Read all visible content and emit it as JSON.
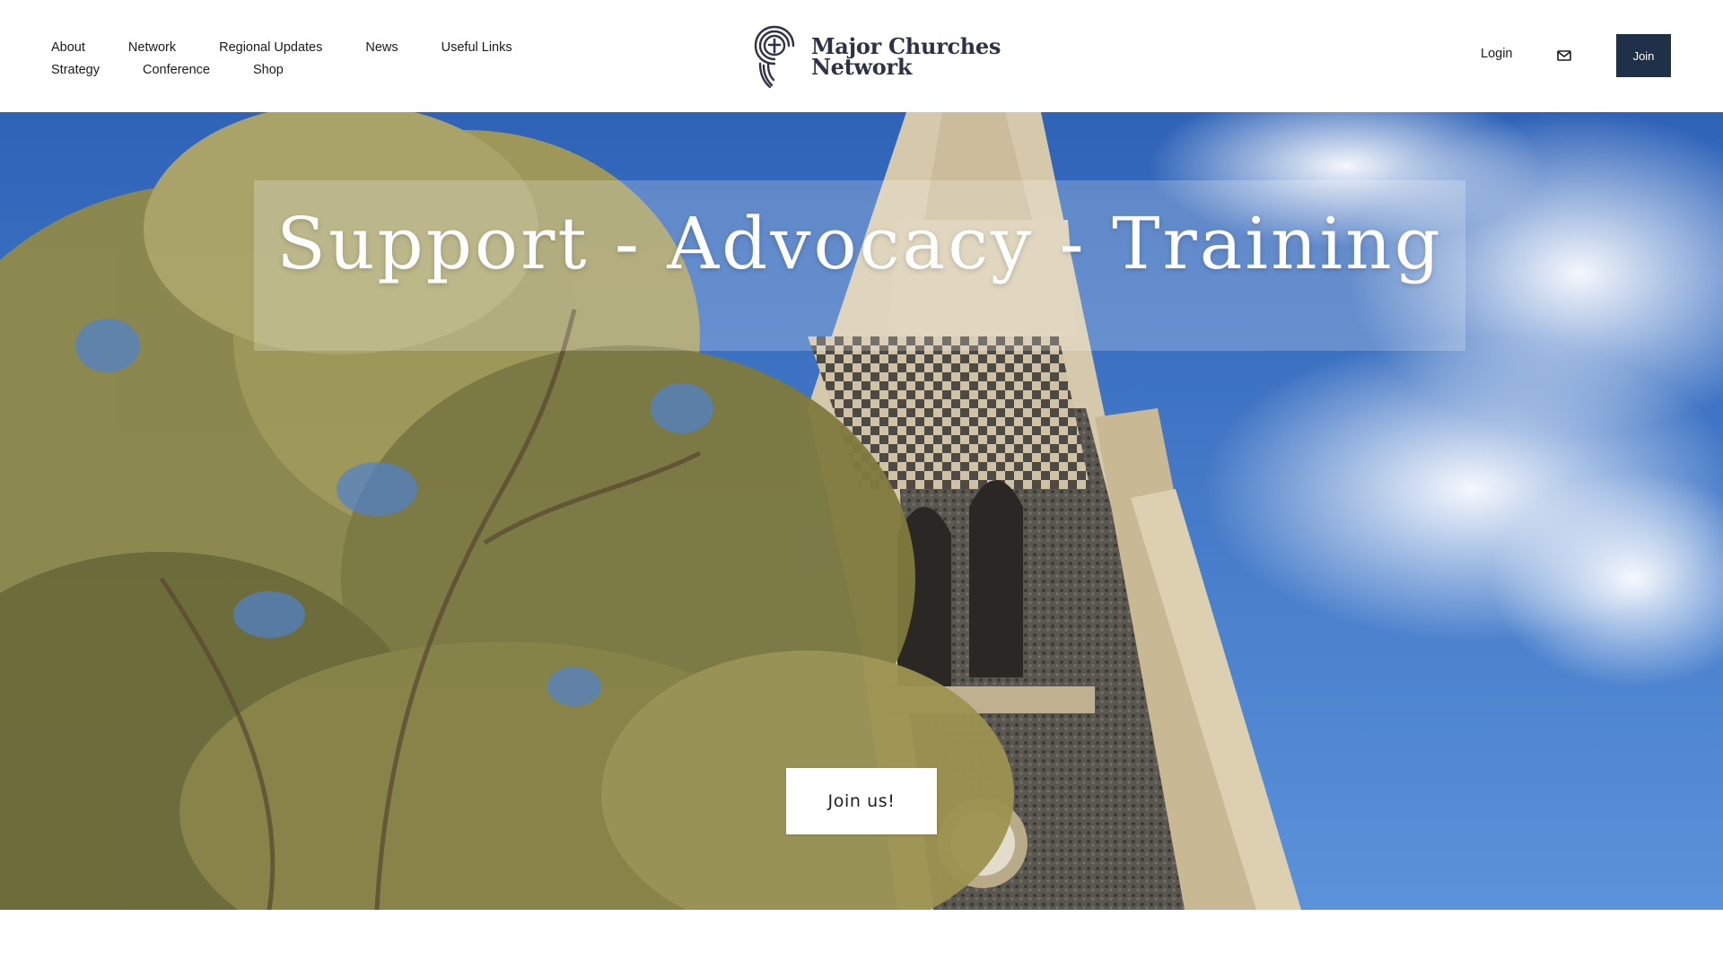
{
  "header": {
    "nav_row1": [
      "About",
      "Network",
      "Regional Updates",
      "News",
      "Useful Links"
    ],
    "nav_row2": [
      "Strategy",
      "Conference",
      "Shop"
    ],
    "logo": {
      "line1": "Major Churches",
      "line2": "Network",
      "icon": "spiral-cross-logo-icon"
    },
    "login_label": "Login",
    "mail_icon": "mail-icon",
    "join_label": "Join"
  },
  "hero": {
    "title": "Support - Advocacy - Training",
    "cta_label": "Join us!"
  },
  "colors": {
    "brand_navy": "#1f3049",
    "logo_text": "#2e3247",
    "sky_blue": "#3f76c7"
  }
}
